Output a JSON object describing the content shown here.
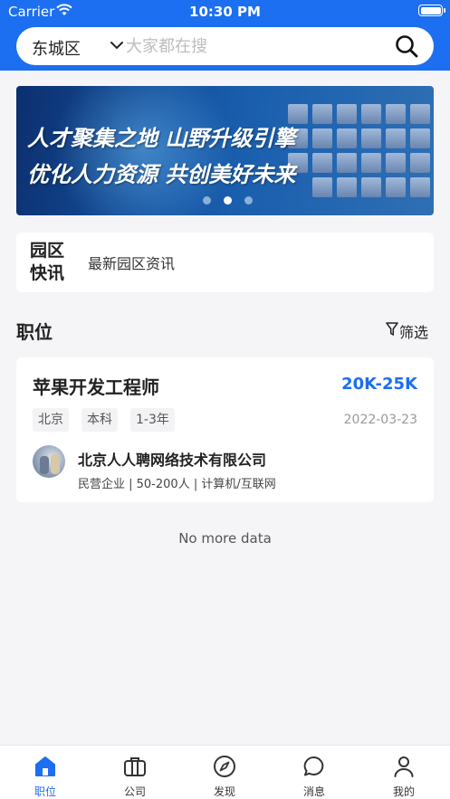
{
  "status_bar": {
    "carrier": "Carrier",
    "time": "10:30 PM"
  },
  "header": {
    "city": "东城区",
    "search_placeholder": "大家都在搜",
    "bg_color": "#1b6ff0"
  },
  "banner": {
    "line1": "人才聚集之地  山野升级引擎",
    "line2": "优化人力资源  共创美好未来",
    "dots": 3,
    "active_dot": 1
  },
  "news": {
    "tag": "园区快讯",
    "text": "最新园区资讯"
  },
  "jobs_section": {
    "title": "职位",
    "filter_label": "筛选"
  },
  "jobs": [
    {
      "title": "苹果开发工程师",
      "salary": "20K-25K",
      "tags": [
        "北京",
        "本科",
        "1-3年"
      ],
      "date": "2022-03-23",
      "company": "北京人人聘网络技术有限公司",
      "company_meta": "民营企业 | 50-200人 | 计算机/互联网"
    }
  ],
  "list_footer": "No more data",
  "tabbar": {
    "active_color": "#1b6ff0",
    "items": [
      {
        "label": "职位",
        "icon": "home-icon",
        "active": true
      },
      {
        "label": "公司",
        "icon": "briefcase-icon",
        "active": false
      },
      {
        "label": "发现",
        "icon": "compass-icon",
        "active": false
      },
      {
        "label": "消息",
        "icon": "chat-bubble-icon",
        "active": false
      },
      {
        "label": "我的",
        "icon": "person-icon",
        "active": false
      }
    ]
  }
}
